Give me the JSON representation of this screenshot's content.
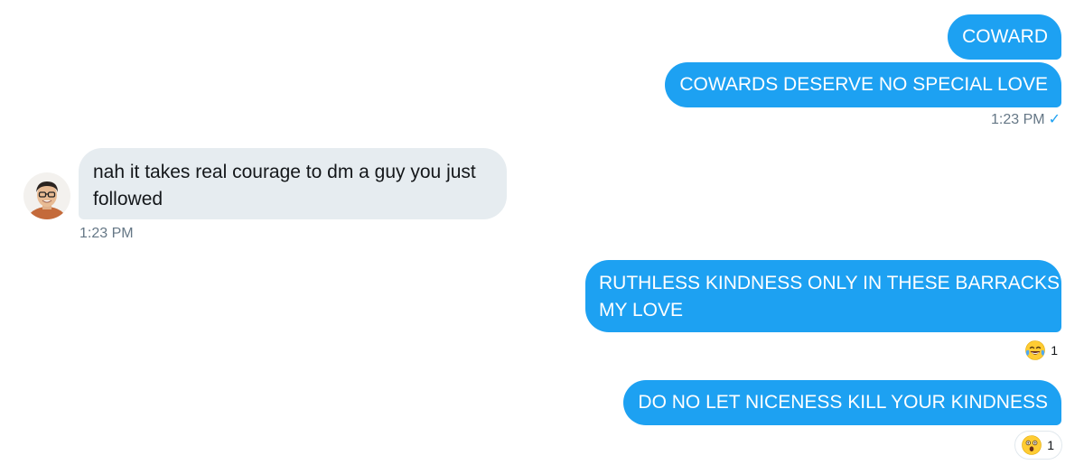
{
  "messages": [
    {
      "direction": "outgoing",
      "text": "COWARD"
    },
    {
      "direction": "outgoing",
      "text": "COWARDS DESERVE NO SPECIAL LOVE"
    },
    {
      "direction": "incoming",
      "text_line1": "nah it takes real courage to dm a guy you just",
      "text_line2": "followed"
    },
    {
      "direction": "outgoing",
      "text_line1": "RUTHLESS KINDNESS ONLY IN THESE BARRACKS",
      "text_line2": "MY LOVE"
    },
    {
      "direction": "outgoing",
      "text": "DO NO LET NICENESS KILL YOUR KINDNESS"
    }
  ],
  "timestamps": {
    "outgoing_1": "1:23 PM",
    "outgoing_1_status": "✓",
    "incoming_1": "1:23 PM"
  },
  "reactions": [
    {
      "emoji": "face-with-tears-of-joy",
      "count": "1"
    },
    {
      "emoji": "astonished-face",
      "count": "1"
    }
  ],
  "colors": {
    "outgoing_bubble": "#1da1f2",
    "incoming_bubble": "#e6ecf0",
    "timestamp": "#657786"
  },
  "icons": {
    "read_receipt": "checkmark-icon",
    "avatar": "user-avatar"
  }
}
